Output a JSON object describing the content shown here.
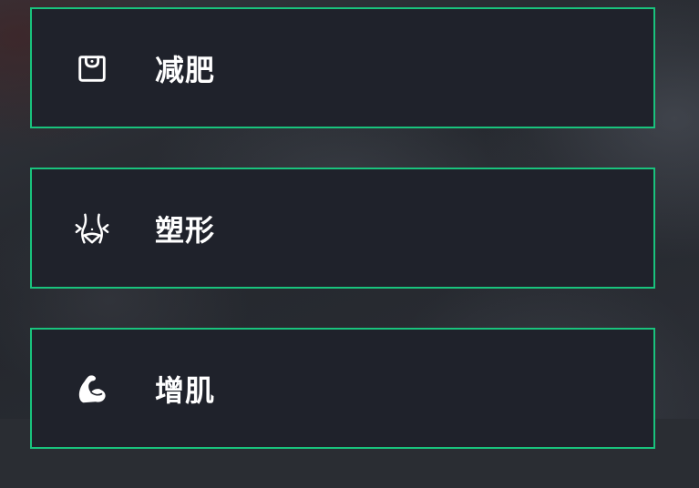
{
  "goals": {
    "options": [
      {
        "label": "减肥",
        "icon": "scale-icon"
      },
      {
        "label": "塑形",
        "icon": "waist-shaping-icon"
      },
      {
        "label": "增肌",
        "icon": "flexed-biceps-icon"
      }
    ]
  },
  "theme": {
    "accent": "#19c37d",
    "card_background": "#1f222b",
    "text": "#ffffff"
  }
}
